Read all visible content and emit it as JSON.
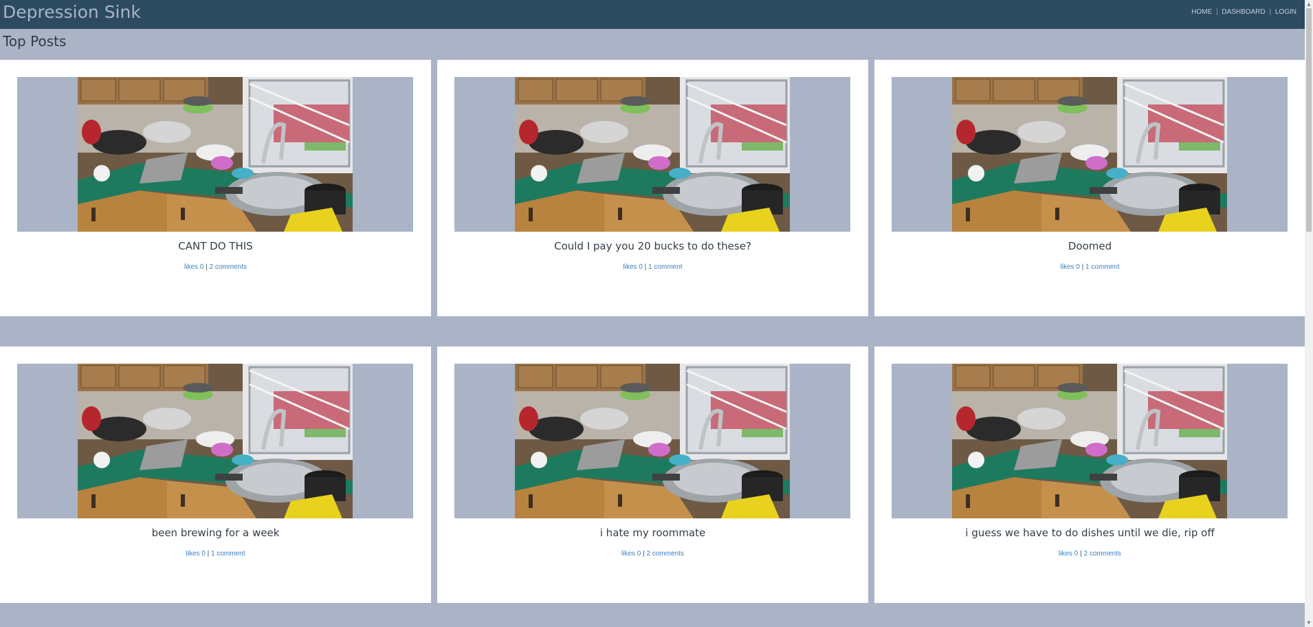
{
  "header": {
    "brand": "Depression Sink",
    "nav": [
      {
        "label": "HOME"
      },
      {
        "label": "DASHBOARD"
      },
      {
        "label": "LOGIN"
      }
    ],
    "nav_separator": "|",
    "background_color": "#2c4b61"
  },
  "page": {
    "section_title": "Top Posts",
    "background_color": "#aab4c6"
  },
  "posts": [
    {
      "title": "CANT DO THIS",
      "likes_label": "likes 0",
      "comments_label": "2 comments",
      "image": "dirty-dishes-sink-photo"
    },
    {
      "title": "Could I pay you 20 bucks to do these?",
      "likes_label": "likes 0",
      "comments_label": "1 comment",
      "image": "dirty-dishes-sink-photo"
    },
    {
      "title": "Doomed",
      "likes_label": "likes 0",
      "comments_label": "1 comment",
      "image": "dirty-dishes-sink-photo"
    },
    {
      "title": "been brewing for a week",
      "likes_label": "likes 0",
      "comments_label": "1 comment",
      "image": "dirty-dishes-sink-photo"
    },
    {
      "title": "i hate my roommate",
      "likes_label": "likes 0",
      "comments_label": "2 comments",
      "image": "dirty-dishes-sink-photo"
    },
    {
      "title": "i guess we have to do dishes until we die, rip off",
      "likes_label": "likes 0",
      "comments_label": "2 comments",
      "image": "dirty-dishes-sink-photo"
    }
  ],
  "meta_separator": "|",
  "colors": {
    "link": "#3a7dc2",
    "card": "#ffffff"
  }
}
